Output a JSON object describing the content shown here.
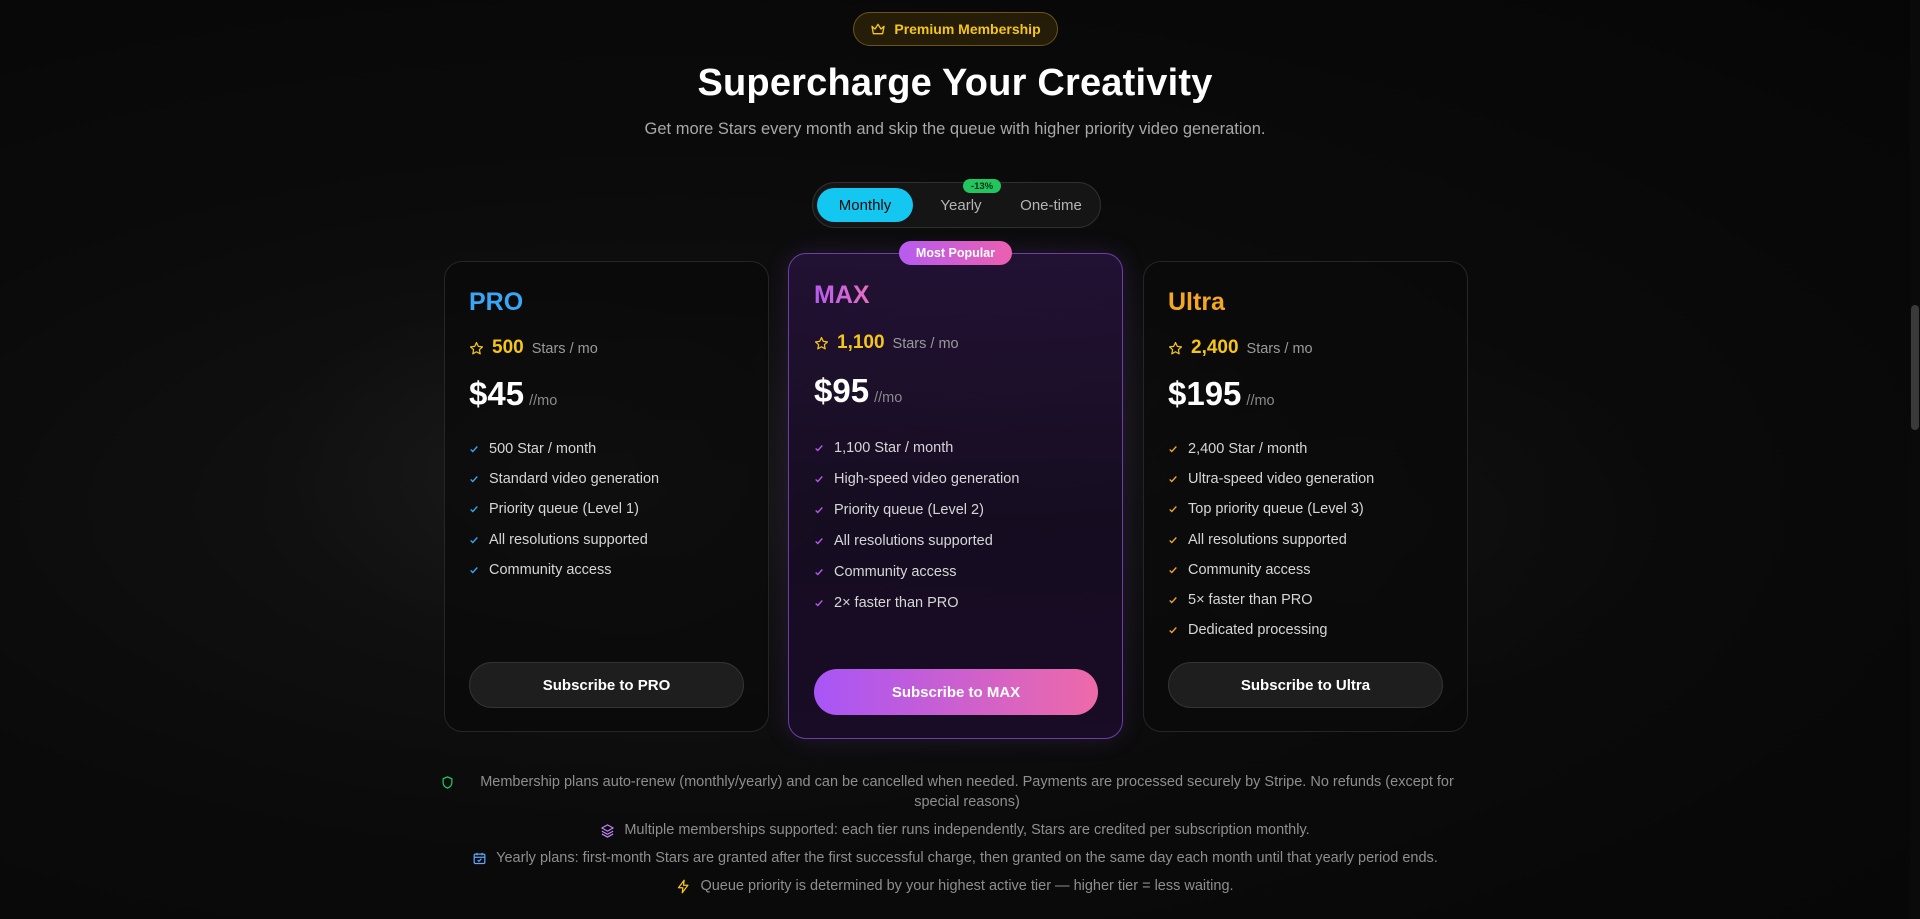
{
  "header": {
    "badge_label": "Premium Membership",
    "title": "Supercharge Your Creativity",
    "subtitle": "Get more Stars every month and skip the queue with higher priority video generation."
  },
  "billing_toggle": {
    "options": [
      "Monthly",
      "Yearly",
      "One-time"
    ],
    "selected": "Monthly",
    "yearly_discount": "-13%"
  },
  "plans": [
    {
      "name": "PRO",
      "stars": "500",
      "stars_unit": "Stars / mo",
      "price": "$45",
      "period": "//mo",
      "features": [
        "500 Star / month",
        "Standard video generation",
        "Priority queue (Level 1)",
        "All resolutions supported",
        "Community access"
      ],
      "button_label": "Subscribe to PRO",
      "accent": "#38a7f5"
    },
    {
      "name": "MAX",
      "badge": "Most Popular",
      "stars": "1,100",
      "stars_unit": "Stars / mo",
      "price": "$95",
      "period": "//mo",
      "features": [
        "1,100 Star / month",
        "High-speed video generation",
        "Priority queue (Level 2)",
        "All resolutions supported",
        "Community access",
        "2× faster than PRO"
      ],
      "button_label": "Subscribe to MAX",
      "accent": "#b65cf0"
    },
    {
      "name": "Ultra",
      "stars": "2,400",
      "stars_unit": "Stars / mo",
      "price": "$195",
      "period": "//mo",
      "features": [
        "2,400 Star / month",
        "Ultra-speed video generation",
        "Top priority queue (Level 3)",
        "All resolutions supported",
        "Community access",
        "5× faster than PRO",
        "Dedicated processing"
      ],
      "button_label": "Subscribe to Ultra",
      "accent": "#f5a623"
    }
  ],
  "notes": [
    {
      "icon": "shield-icon",
      "text": "Membership plans auto-renew (monthly/yearly) and can be cancelled when needed. Payments are processed securely by Stripe. No refunds (except for special reasons)"
    },
    {
      "icon": "layers-icon",
      "text": "Multiple memberships supported: each tier runs independently, Stars are credited per subscription monthly."
    },
    {
      "icon": "calendar-icon",
      "text": "Yearly plans: first-month Stars are granted after the first successful charge, then granted on the same day each month until that yearly period ends."
    },
    {
      "icon": "lightning-icon",
      "text": "Queue priority is determined by your highest active tier — higher tier = less waiting."
    }
  ],
  "colors": {
    "toggle_active": "#14c7f0",
    "star": "#f5c518",
    "discount": "#22c55e",
    "shield": "#22c55e",
    "layers": "#c084fc",
    "calendar": "#60a5fa",
    "lightning": "#f5c518"
  }
}
